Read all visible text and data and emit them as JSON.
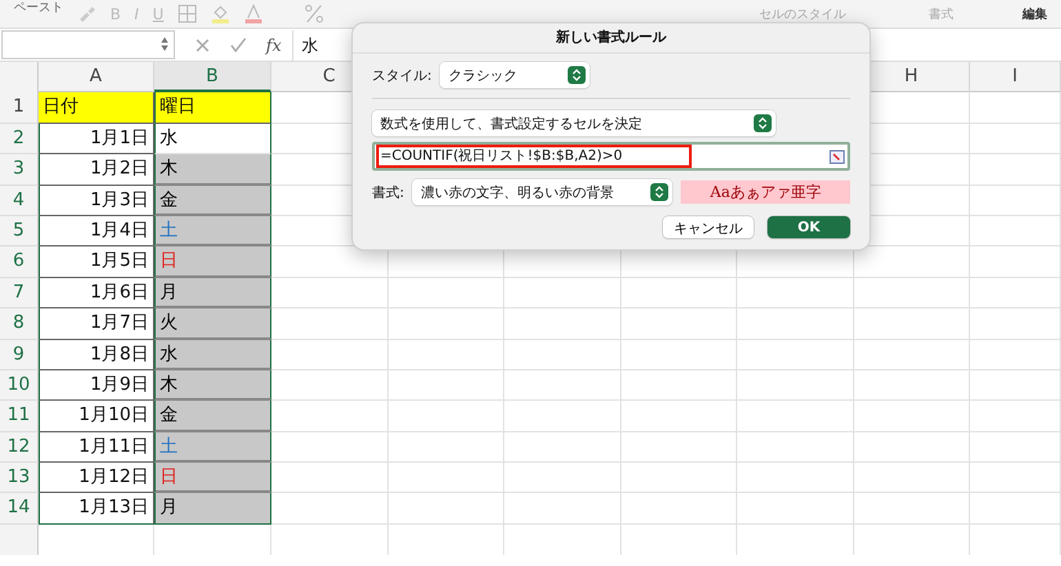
{
  "ribbon": {
    "paste_label": "ペースト",
    "font_buttons": [
      "B",
      "I",
      "U"
    ],
    "cell_styles": "セルのスタイル",
    "format": "書式",
    "edit": "編集"
  },
  "formula_bar": {
    "value": "水",
    "fx": "fx"
  },
  "sheet": {
    "columns": [
      {
        "label": "A",
        "selected": false
      },
      {
        "label": "B",
        "selected": true
      },
      {
        "label": "C",
        "selected": false
      },
      {
        "label": "H",
        "selected": false
      },
      {
        "label": "I",
        "selected": false
      }
    ],
    "header_row": {
      "number": "1",
      "date": "日付",
      "weekday": "曜日"
    },
    "rows": [
      {
        "number": "2",
        "date": "1月1日",
        "weekday": "水",
        "shaded": false,
        "color": "#000000",
        "selected": true
      },
      {
        "number": "3",
        "date": "1月2日",
        "weekday": "木",
        "shaded": true,
        "color": "#000000",
        "selected": true
      },
      {
        "number": "4",
        "date": "1月3日",
        "weekday": "金",
        "shaded": true,
        "color": "#000000",
        "selected": true
      },
      {
        "number": "5",
        "date": "1月4日",
        "weekday": "土",
        "shaded": true,
        "color": "#1f6fc0",
        "selected": true
      },
      {
        "number": "6",
        "date": "1月5日",
        "weekday": "日",
        "shaded": true,
        "color": "#e0201c",
        "selected": true
      },
      {
        "number": "7",
        "date": "1月6日",
        "weekday": "月",
        "shaded": true,
        "color": "#000000",
        "selected": true
      },
      {
        "number": "8",
        "date": "1月7日",
        "weekday": "火",
        "shaded": true,
        "color": "#000000",
        "selected": true
      },
      {
        "number": "9",
        "date": "1月8日",
        "weekday": "水",
        "shaded": true,
        "color": "#000000",
        "selected": true
      },
      {
        "number": "10",
        "date": "1月9日",
        "weekday": "木",
        "shaded": true,
        "color": "#000000",
        "selected": true
      },
      {
        "number": "11",
        "date": "1月10日",
        "weekday": "金",
        "shaded": true,
        "color": "#000000",
        "selected": true
      },
      {
        "number": "12",
        "date": "1月11日",
        "weekday": "土",
        "shaded": true,
        "color": "#1f6fc0",
        "selected": true
      },
      {
        "number": "13",
        "date": "1月12日",
        "weekday": "日",
        "shaded": true,
        "color": "#e0201c",
        "selected": true
      },
      {
        "number": "14",
        "date": "1月13日",
        "weekday": "月",
        "shaded": true,
        "color": "#000000",
        "selected": true
      }
    ]
  },
  "dialog": {
    "title": "新しい書式ルール",
    "style_label": "スタイル:",
    "style_value": "クラシック",
    "rule_type": "数式を使用して、書式設定するセルを決定",
    "formula": "=COUNTIF(祝日リスト!$B:$B,A2)>0",
    "formula_highlighted": true,
    "format_label": "書式:",
    "format_value": "濃い赤の文字、明るい赤の背景",
    "preview": "Aaあぁアァ亜字",
    "buttons": [
      {
        "label": "キャンセル",
        "kind": "secondary"
      },
      {
        "label": "OK",
        "kind": "primary"
      }
    ]
  }
}
